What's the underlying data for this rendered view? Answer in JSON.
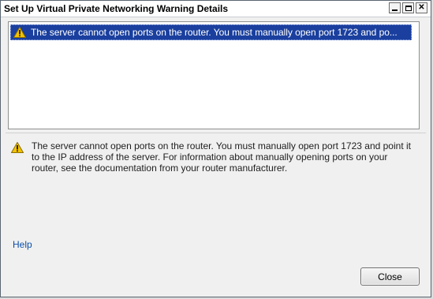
{
  "window": {
    "title": "Set Up Virtual Private Networking Warning Details",
    "buttons": {
      "minimize": "minimize",
      "maximize": "maximize",
      "close": "✕"
    }
  },
  "list": {
    "items": [
      {
        "icon": "warning-icon",
        "text": "The server cannot open ports on the router. You must manually open port 1723 and po..."
      }
    ]
  },
  "detail": {
    "icon": "warning-icon",
    "text": "The server cannot open ports on the router. You must manually open port 1723 and point it to the IP address of the server. For information about manually opening ports on your router, see the documentation from your router manufacturer."
  },
  "links": {
    "help": "Help"
  },
  "footer": {
    "close_label": "Close"
  },
  "colors": {
    "selection": "#1a3f9e",
    "link": "#0b4fa8",
    "warning": "#f2c200"
  }
}
